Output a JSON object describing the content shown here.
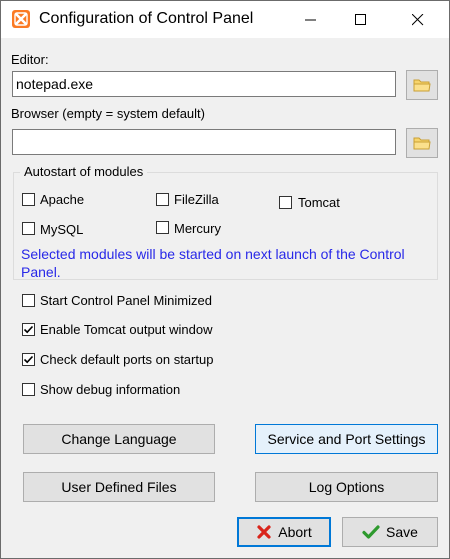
{
  "window": {
    "title": "Configuration of Control Panel"
  },
  "editor": {
    "label": "Editor:",
    "value": "notepad.exe"
  },
  "browser": {
    "label": "Browser (empty = system default)",
    "value": ""
  },
  "autostart": {
    "title": "Autostart of modules",
    "modules": [
      {
        "label": "Apache",
        "checked": false
      },
      {
        "label": "FileZilla",
        "checked": false
      },
      {
        "label": "Tomcat",
        "checked": false
      },
      {
        "label": "MySQL",
        "checked": false
      },
      {
        "label": "Mercury",
        "checked": false
      }
    ],
    "note": "Selected modules will be started on next launch of the Control Panel."
  },
  "options": [
    {
      "label": "Start Control Panel Minimized",
      "checked": false
    },
    {
      "label": "Enable Tomcat output window",
      "checked": true
    },
    {
      "label": "Check default ports on startup",
      "checked": true
    },
    {
      "label": "Show debug information",
      "checked": false
    }
  ],
  "buttons": {
    "change_language": "Change Language",
    "service_port_settings": "Service and Port Settings",
    "user_defined_files": "User Defined Files",
    "log_options": "Log Options",
    "abort": "Abort",
    "save": "Save"
  },
  "colors": {
    "note_text": "#2828e8",
    "accent": "#0078d7",
    "app_icon": "#fb7a24"
  }
}
